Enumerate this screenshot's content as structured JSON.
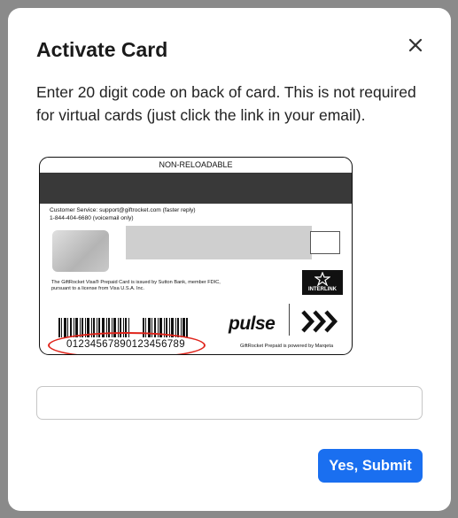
{
  "modal": {
    "title": "Activate Card",
    "description": "Enter 20 digit code on back of card. This is not required for virtual cards (just click the link in your email).",
    "close_icon": "close-icon"
  },
  "card": {
    "header": "NON-RELOADABLE",
    "customer_service": "Customer Service: support@giftrocket.com (faster reply)\n1-844-404-6680 (voicemail only)",
    "legal": "The GiftRocket Visa® Prepaid Card is issued by Sutton Bank, member FDIC,\npursuant to a license from Visa U.S.A. Inc.",
    "interlink_label": "INTERLINK",
    "barcode_number": "01234567890123456789",
    "pulse_logo": "pulse",
    "powered_by": "GiftRocket Prepaid is powered by Marqeta",
    "highlight_color": "#e0241b"
  },
  "form": {
    "code_value": "",
    "code_placeholder": "",
    "submit_label": "Yes, Submit",
    "submit_color": "#1a6ff0"
  }
}
